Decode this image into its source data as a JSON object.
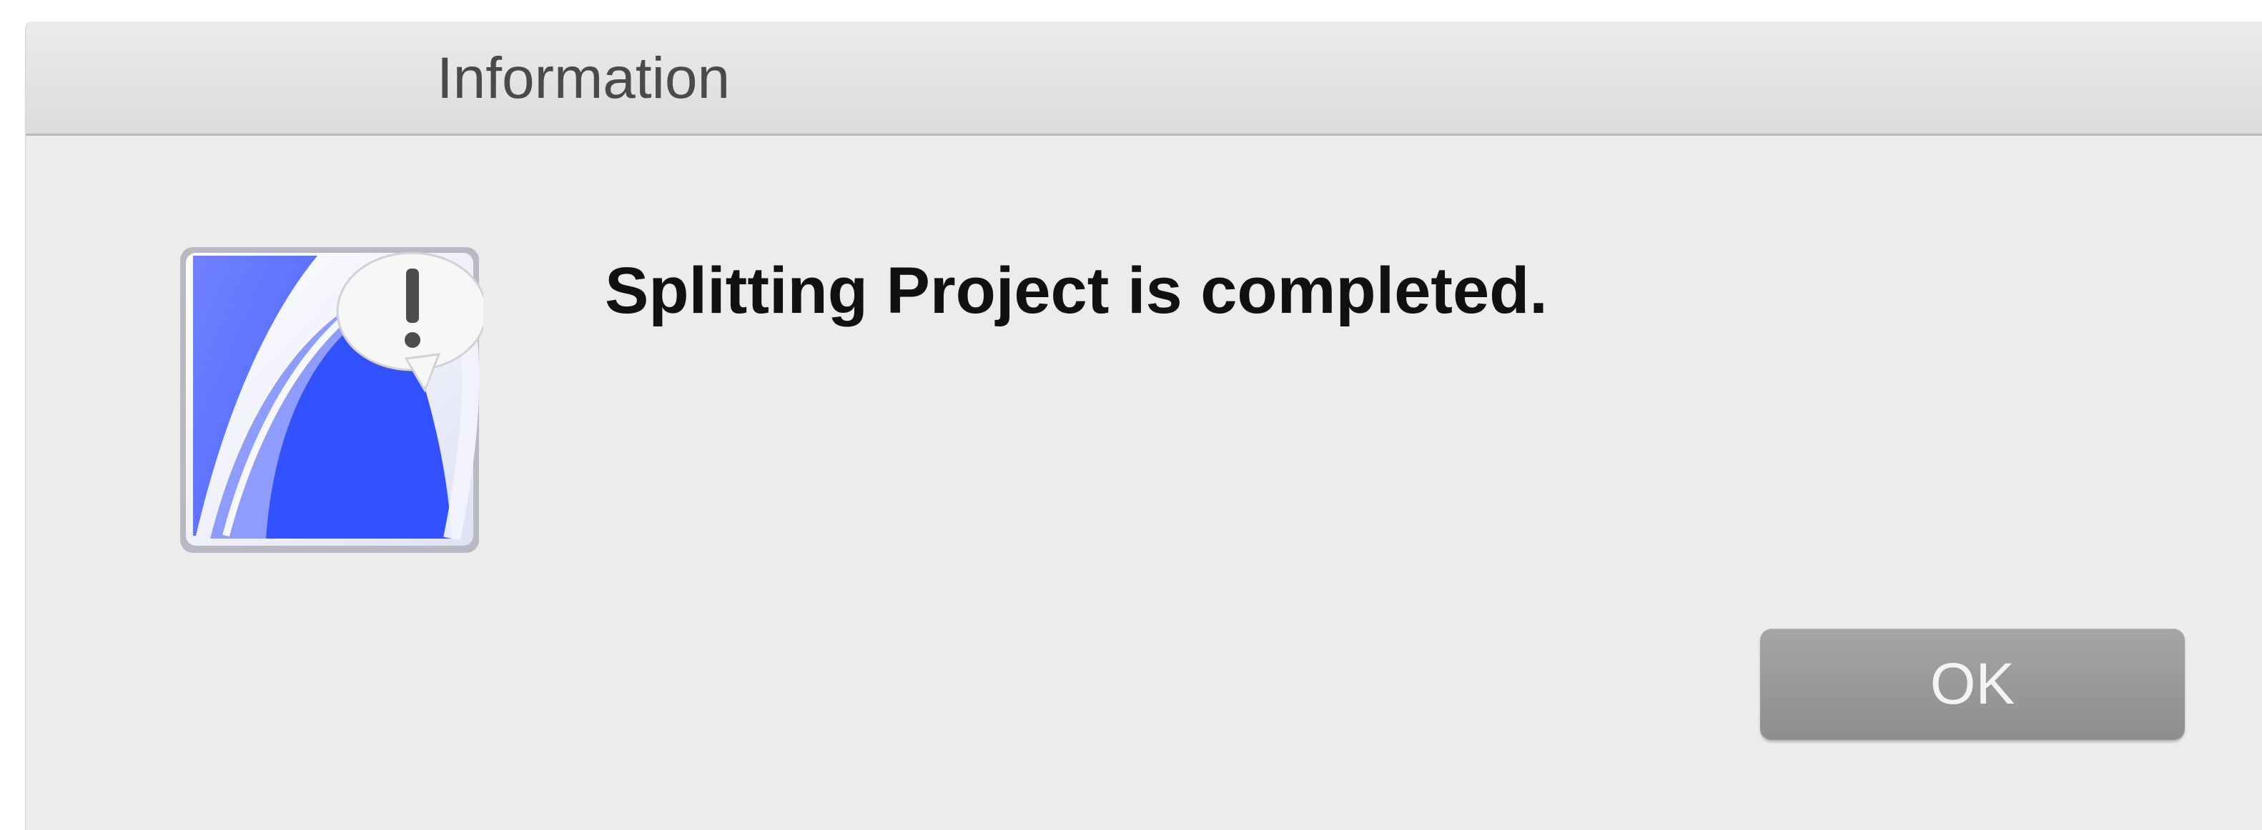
{
  "window": {
    "title": "Information"
  },
  "dialog": {
    "message": "Splitting Project is completed.",
    "icon": "archicad-app-icon-with-alert-badge"
  },
  "buttons": {
    "ok_label": "OK"
  },
  "colors": {
    "icon_blue": "#3350f5",
    "icon_light_blue": "#7f8ff5",
    "button_gray": "#9a9a9a",
    "dialog_background": "#ececec"
  }
}
